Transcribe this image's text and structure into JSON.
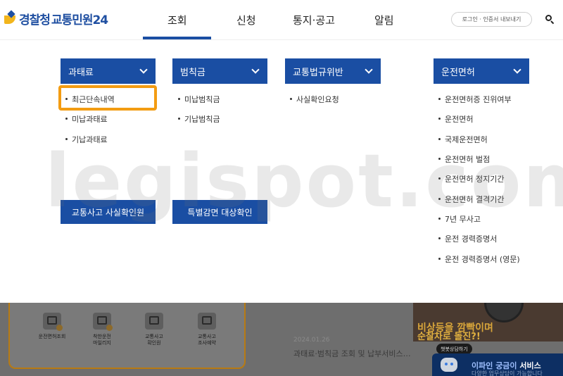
{
  "header": {
    "logo_police": "경찰청",
    "logo_service": "교통민원24",
    "nav": [
      "조회",
      "신청",
      "통지·공고",
      "알림"
    ],
    "active_nav": "조회",
    "login_label": "로그인 · 인증서 내보내기",
    "search_icon": "search-icon"
  },
  "menu": {
    "categories": [
      {
        "label": "과태료",
        "items": [
          "최근단속내역",
          "미납과태료",
          "기납과태료"
        ]
      },
      {
        "label": "범칙금",
        "items": [
          "미납범칙금",
          "기납범칙금"
        ]
      },
      {
        "label": "교통법규위반",
        "items": [
          "사실확인요청"
        ]
      },
      {
        "label": "운전면허",
        "items": [
          "운전면허증 진위여부",
          "운전면허",
          "국제운전면허",
          "운전면허 벌점",
          "운전면허 정지기간",
          "운전면허 결격기간",
          "7년 무사고",
          "운전 경력증명서",
          "운전 경력증명서 (영문)"
        ]
      }
    ],
    "highlighted_item": "최근단속내역",
    "buttons": [
      "교통사고 사실확인원",
      "특별감면 대상확인"
    ],
    "highlight_color": "#f39c12",
    "accent_color": "#1a4ea3"
  },
  "watermark": "legispot.com",
  "background": {
    "quick_links": [
      {
        "line1": "운전면허조회",
        "line2": ""
      },
      {
        "line1": "착한운전",
        "line2": "마일리지"
      },
      {
        "line1": "교통사고",
        "line2": "확인원"
      },
      {
        "line1": "교통사고",
        "line2": "조사예약"
      }
    ],
    "news_date": "2024.01.26",
    "news_title": "과태료·범칙금 조회 및 납부서비스…",
    "promo_line1": "비상등을 깜빡이며",
    "promo_line2": "순찰차로 돌진?!",
    "chat_bubble": "챗봇상담하기",
    "chat_title_a": "이파인 궁금이",
    "chat_title_b": "서비스",
    "chat_sub": "다양한 업무상담이 가능합니다"
  }
}
